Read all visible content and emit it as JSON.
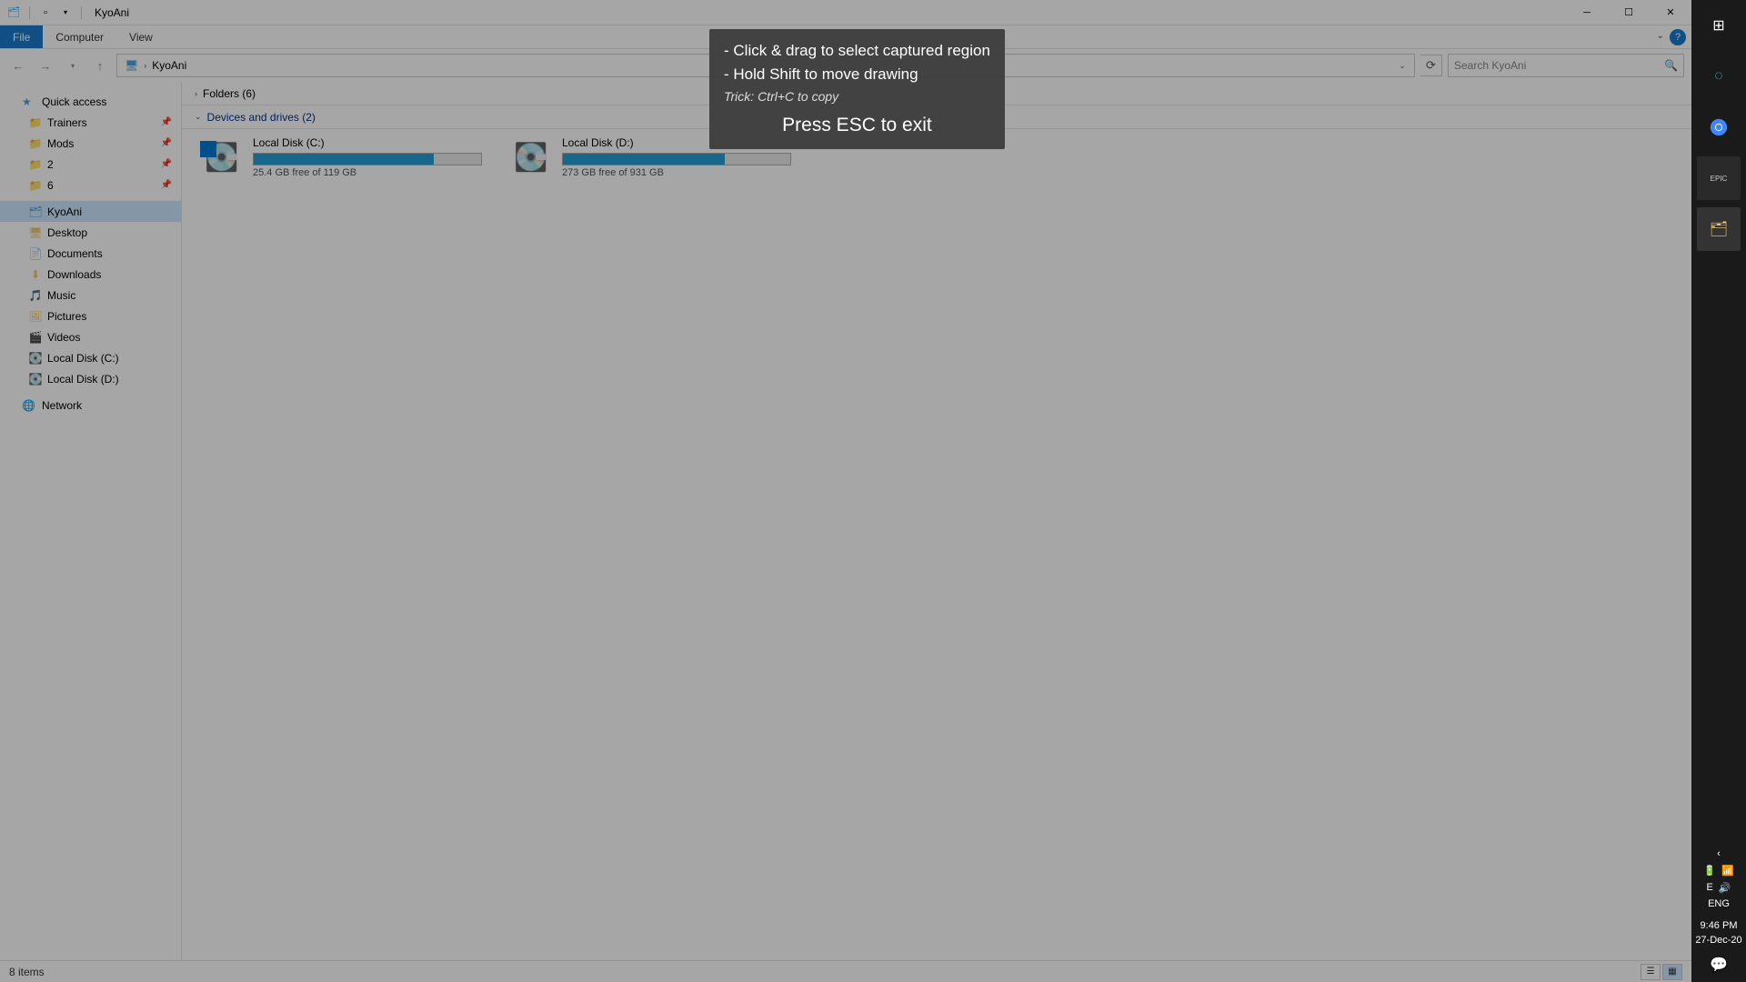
{
  "window": {
    "title": "KyoAni"
  },
  "ribbon": {
    "file": "File",
    "computer": "Computer",
    "view": "View"
  },
  "breadcrumb": {
    "segment": "KyoAni"
  },
  "search": {
    "placeholder": "Search KyoAni"
  },
  "nav": {
    "quick_access": "Quick access",
    "items": [
      {
        "label": "Trainers",
        "pinned": true
      },
      {
        "label": "Mods",
        "pinned": true
      },
      {
        "label": "2",
        "pinned": true
      },
      {
        "label": "6",
        "pinned": true
      }
    ],
    "selected": "KyoAni",
    "under": [
      {
        "label": "Desktop"
      },
      {
        "label": "Documents"
      },
      {
        "label": "Downloads"
      },
      {
        "label": "Music"
      },
      {
        "label": "Pictures"
      },
      {
        "label": "Videos"
      },
      {
        "label": "Local Disk (C:)"
      },
      {
        "label": "Local Disk (D:)"
      }
    ],
    "network": "Network"
  },
  "groups": {
    "folders": "Folders (6)",
    "devices": "Devices and drives (2)"
  },
  "drives": [
    {
      "name": "Local Disk (C:)",
      "free": "25.4 GB free of 119 GB",
      "fill_pct": 79
    },
    {
      "name": "Local Disk (D:)",
      "free": "273 GB free of 931 GB",
      "fill_pct": 71
    }
  ],
  "status": {
    "items": "8 items"
  },
  "tip": {
    "line1": "- Click & drag to select captured region",
    "line2": "- Hold Shift to move drawing",
    "trick": "Trick: Ctrl+C to copy",
    "esc": "Press ESC to exit"
  },
  "tray": {
    "lang": "ENG",
    "ime": "E",
    "time": "9:46 PM",
    "date": "27-Dec-20"
  },
  "taskbar_apps": [
    "windows",
    "app-c",
    "chrome",
    "epic",
    "explorer"
  ]
}
